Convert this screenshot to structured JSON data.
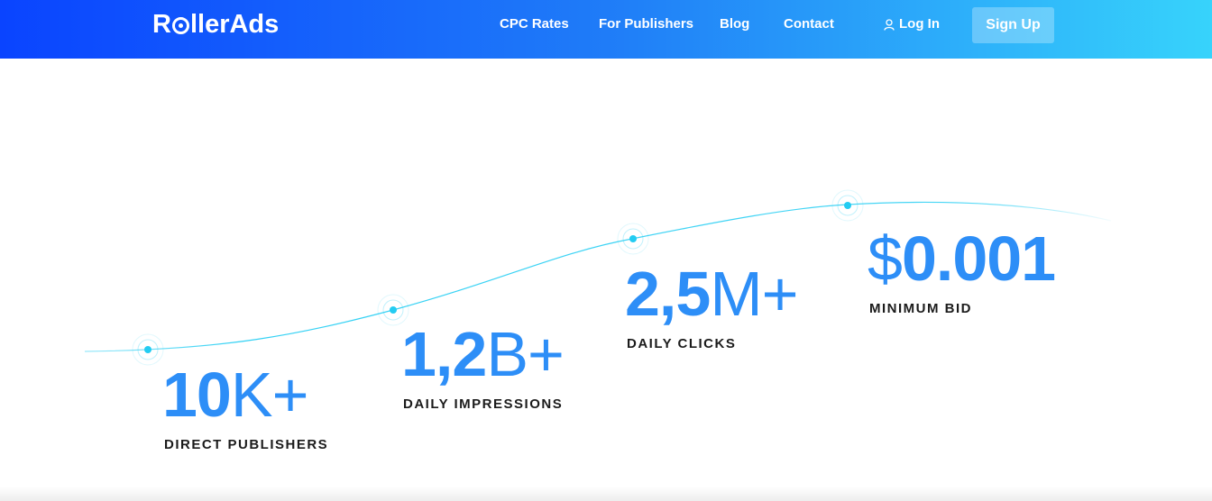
{
  "header": {
    "logo": {
      "before": "R",
      "after": "llerAds"
    },
    "nav": [
      {
        "label": "CPC Rates"
      },
      {
        "label": "For Publishers"
      },
      {
        "label": "Blog"
      },
      {
        "label": "Contact"
      }
    ],
    "login_label": "Log In",
    "signup_label": "Sign Up"
  },
  "stats": [
    {
      "bold": "10",
      "light": "K+",
      "label": "DIRECT PUBLISHERS"
    },
    {
      "bold": "1,2",
      "light": "B+",
      "label": "DAILY IMPRESSIONS"
    },
    {
      "bold": "2,5",
      "light": "M+",
      "label": "DAILY CLICKS"
    },
    {
      "bold": "0.001",
      "light": "$",
      "label": "MINIMUM BID"
    }
  ],
  "colors": {
    "header_gradient": [
      "#0a44ff",
      "#1f7cf8",
      "#37d3fb"
    ],
    "stat_number": "#2d8ef7",
    "curve": "#33d1f4"
  }
}
